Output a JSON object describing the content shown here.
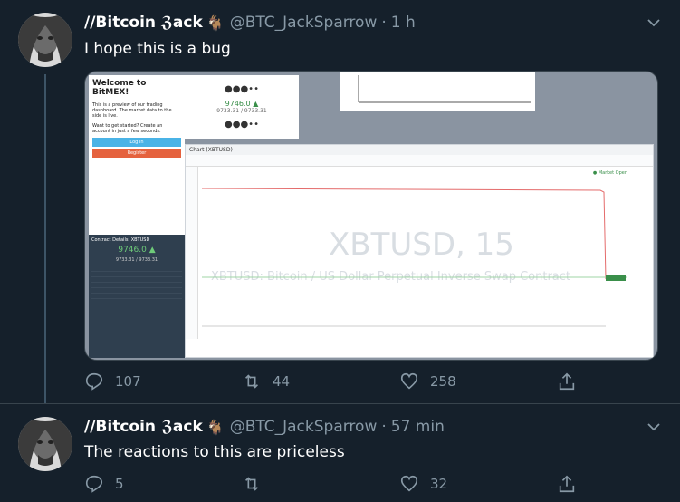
{
  "tweets": [
    {
      "name": "//Bitcoin ℨack",
      "handle": "@BTC_JackSparrow",
      "dot": "·",
      "time": "1 h",
      "text": "I hope this is a bug",
      "replies": "107",
      "retweets": "44",
      "likes": "258"
    },
    {
      "name": "//Bitcoin ℨack",
      "handle": "@BTC_JackSparrow",
      "dot": "·",
      "time": "57 min",
      "text": "The reactions to this are priceless",
      "replies": "5",
      "retweets": "",
      "likes": "32"
    }
  ],
  "screenshot": {
    "welcome_title": "Welcome to BitMEX!",
    "welcome_text": "This is a preview of our trading dashboard. The market data to the side is live.",
    "get_started": "Want to get started? Create an account in just a few seconds.",
    "login": "Log In",
    "register": "Register",
    "contract_header": "Contract Details: XBTUSD",
    "price": "9746.0 ▲",
    "sub_price": "9733.31 / 9733.31",
    "chart_title": "Chart (XBTUSD)",
    "watermark": "XBTUSD, 15",
    "watermark_sub": "XBTUSD: Bitcoin / US Dollar Perpetual Inverse Swap Contract",
    "market_open": "● Market Open"
  },
  "colors": {
    "bg": "#15202b",
    "muted": "#8899a6",
    "line": "#3d5466"
  }
}
